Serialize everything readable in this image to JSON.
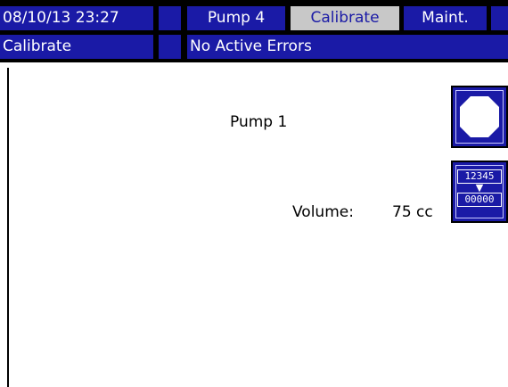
{
  "header": {
    "datetime": "08/10/13 23:27",
    "tabs": [
      {
        "label": "Pump 4"
      },
      {
        "label": "Calibrate"
      },
      {
        "label": "Maint."
      }
    ]
  },
  "status": {
    "screen": "Calibrate",
    "errors": "No Active Errors"
  },
  "main": {
    "pump_label": "Pump 1",
    "volume_label": "Volume:",
    "volume_value": "75 cc",
    "reset_button": {
      "top": "12345",
      "bottom": "00000"
    }
  },
  "colors": {
    "bar_blue": "#1a1aa6",
    "selected_tab": "#c8c8c8",
    "stop_icon": "#ffffff"
  },
  "icons": [
    "stop-icon",
    "reset-counter-icon"
  ]
}
